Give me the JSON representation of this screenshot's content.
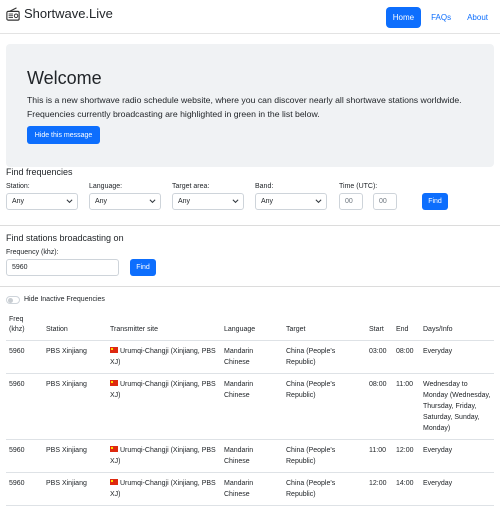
{
  "app": {
    "title": "Shortwave.Live",
    "accent": "#0d6efd"
  },
  "nav": {
    "home": "Home",
    "faqs": "FAQs",
    "about": "About"
  },
  "welcome": {
    "heading": "Welcome",
    "text": "This is a new shortwave radio schedule website, where you can discover nearly all shortwave stations worldwide. Frequencies currently broadcasting are highlighted in green in the list below.",
    "hide_button": "Hide this message"
  },
  "find_frequencies": {
    "title": "Find frequencies",
    "station_label": "Station:",
    "station_value": "Any",
    "language_label": "Language:",
    "language_value": "Any",
    "target_label": "Target area:",
    "target_value": "Any",
    "band_label": "Band:",
    "band_value": "Any",
    "time_label": "Time (UTC):",
    "time_start_placeholder": "00",
    "time_end_placeholder": "00",
    "find_button": "Find"
  },
  "find_stations": {
    "title": "Find stations broadcasting on",
    "freq_label": "Frequency (khz):",
    "freq_value": "5960",
    "find_button": "Find"
  },
  "toggle": {
    "label": "Hide Inactive Frequencies",
    "checked": false
  },
  "table": {
    "headers": {
      "freq": "Freq (khz)",
      "station": "Station",
      "site": "Transmitter site",
      "language": "Language",
      "target": "Target",
      "start": "Start",
      "end": "End",
      "days": "Days/Info"
    },
    "rows": [
      {
        "freq": "5960",
        "station": "PBS Xinjiang",
        "site": "Urumqi-Changji (Xinjiang, PBS XJ)",
        "language": "Mandarin Chinese",
        "target": "China (People's Republic)",
        "start": "03:00",
        "end": "08:00",
        "days": "Everyday"
      },
      {
        "freq": "5960",
        "station": "PBS Xinjiang",
        "site": "Urumqi-Changji (Xinjiang, PBS XJ)",
        "language": "Mandarin Chinese",
        "target": "China (People's Republic)",
        "start": "08:00",
        "end": "11:00",
        "days": "Wednesday to Monday (Wednesday, Thursday, Friday, Saturday, Sunday, Monday)"
      },
      {
        "freq": "5960",
        "station": "PBS Xinjiang",
        "site": "Urumqi-Changji (Xinjiang, PBS XJ)",
        "language": "Mandarin Chinese",
        "target": "China (People's Republic)",
        "start": "11:00",
        "end": "12:00",
        "days": "Everyday"
      },
      {
        "freq": "5960",
        "station": "PBS Xinjiang",
        "site": "Urumqi-Changji (Xinjiang, PBS XJ)",
        "language": "Mandarin Chinese",
        "target": "China (People's Republic)",
        "start": "12:00",
        "end": "14:00",
        "days": "Everyday"
      }
    ]
  }
}
